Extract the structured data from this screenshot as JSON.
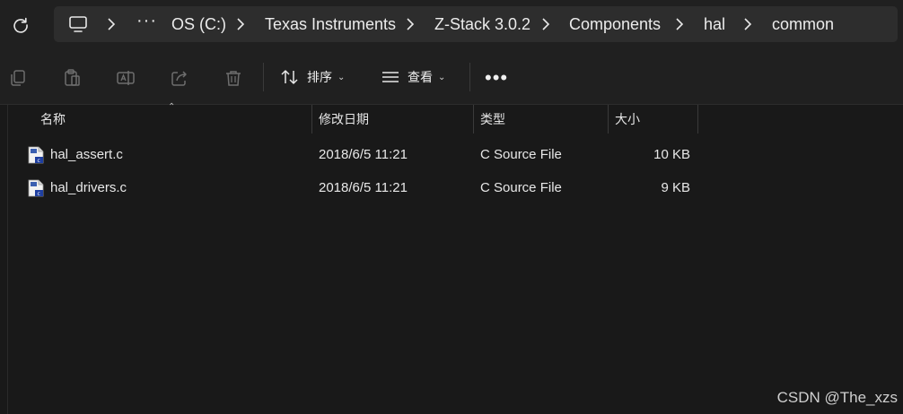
{
  "breadcrumb": {
    "items": [
      "OS (C:)",
      "Texas Instruments",
      "Z-Stack 3.0.2",
      "Components",
      "hal",
      "common"
    ]
  },
  "toolbar": {
    "sort_label": "排序",
    "view_label": "查看"
  },
  "columns": {
    "name": "名称",
    "date": "修改日期",
    "type": "类型",
    "size": "大小"
  },
  "files": [
    {
      "name": "hal_assert.c",
      "date": "2018/6/5 11:21",
      "type": "C Source File",
      "size": "10 KB"
    },
    {
      "name": "hal_drivers.c",
      "date": "2018/6/5 11:21",
      "type": "C Source File",
      "size": "9 KB"
    }
  ],
  "watermark": "CSDN @The_xzs",
  "colors": {
    "background": "#191919",
    "toolbar": "#202020",
    "address_box": "#2d2d2d",
    "text": "#e8e8e8"
  }
}
